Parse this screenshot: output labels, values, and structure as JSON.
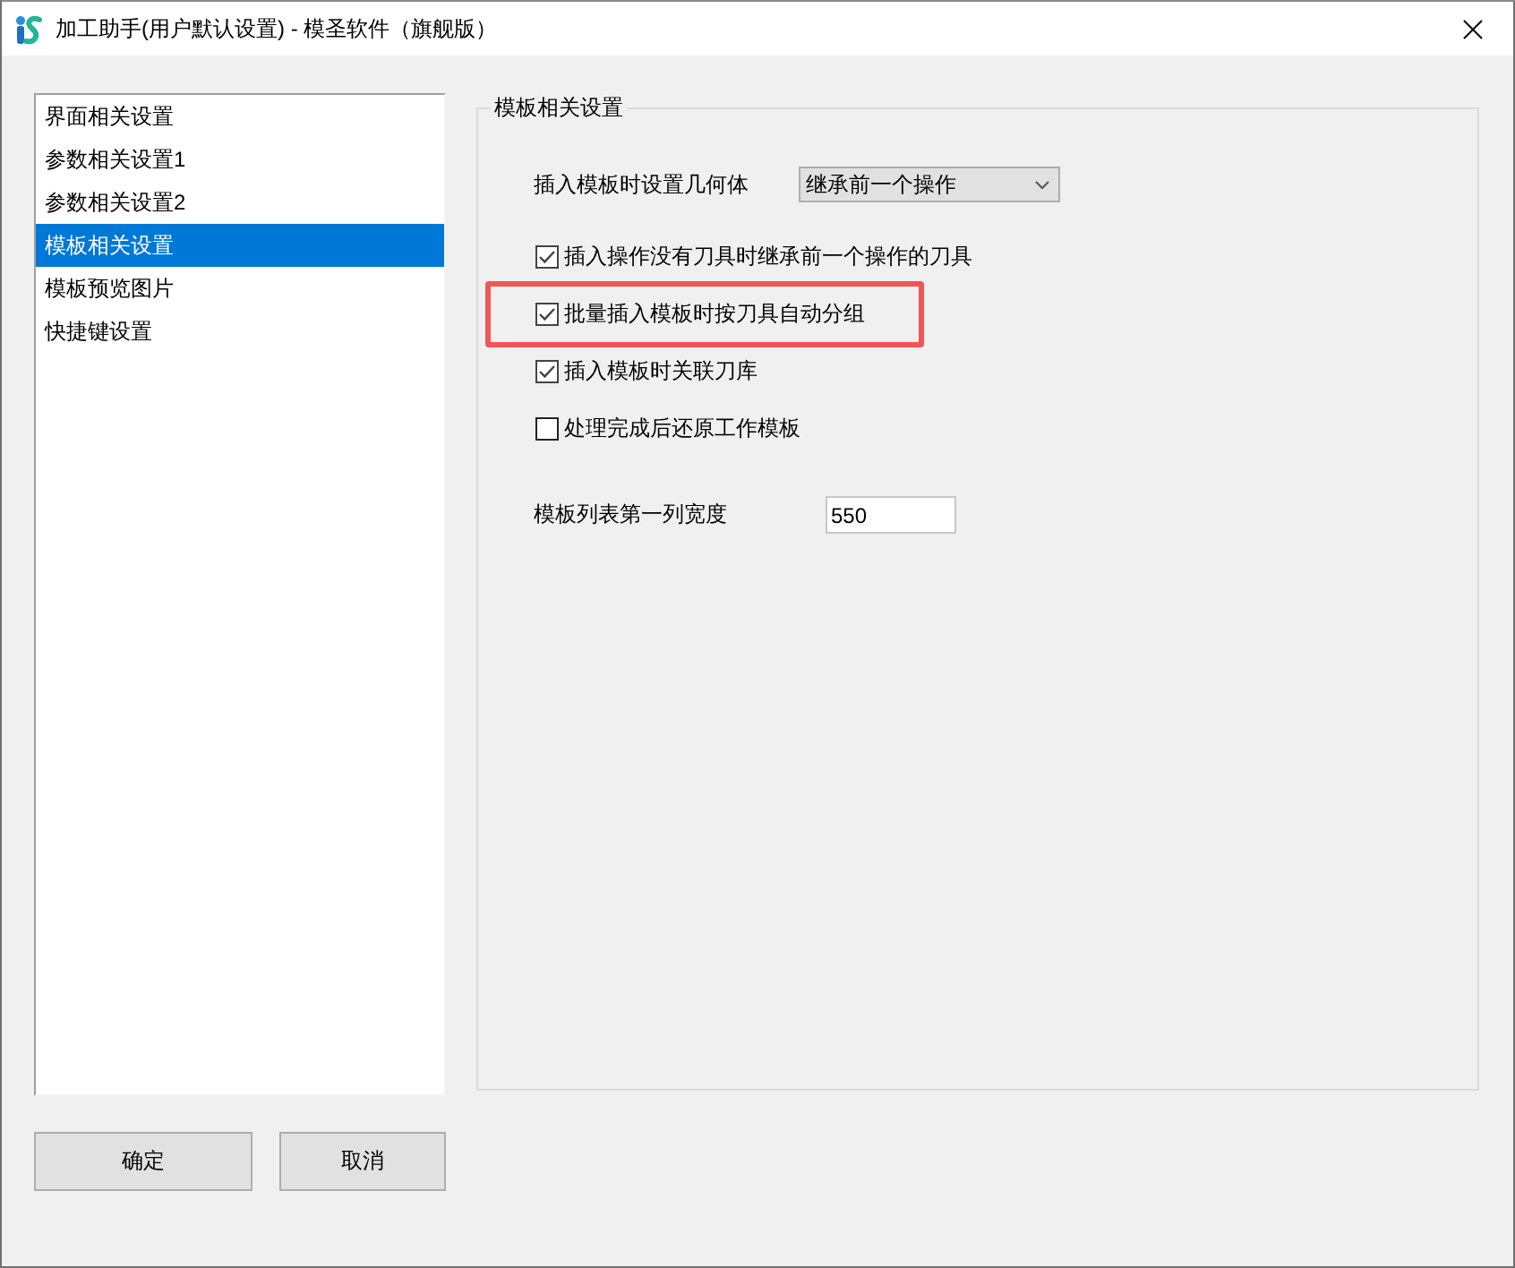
{
  "window": {
    "title": "加工助手(用户默认设置) - 模圣软件（旗舰版）"
  },
  "sidebar": {
    "items": [
      {
        "label": "界面相关设置",
        "selected": false
      },
      {
        "label": "参数相关设置1",
        "selected": false
      },
      {
        "label": "参数相关设置2",
        "selected": false
      },
      {
        "label": "模板相关设置",
        "selected": true
      },
      {
        "label": "模板预览图片",
        "selected": false
      },
      {
        "label": "快捷键设置",
        "selected": false
      }
    ]
  },
  "group": {
    "title": "模板相关设置",
    "geometry_setting": {
      "label": "插入模板时设置几何体",
      "value": "继承前一个操作"
    },
    "options": [
      {
        "label": "插入操作没有刀具时继承前一个操作的刀具",
        "checked": true,
        "highlighted": false
      },
      {
        "label": "批量插入模板时按刀具自动分组",
        "checked": true,
        "highlighted": true
      },
      {
        "label": "插入模板时关联刀库",
        "checked": true,
        "highlighted": false
      },
      {
        "label": "处理完成后还原工作模板",
        "checked": false,
        "highlighted": false
      }
    ],
    "column_width": {
      "label": "模板列表第一列宽度",
      "value": "550"
    }
  },
  "buttons": [
    "确定",
    "取消"
  ]
}
